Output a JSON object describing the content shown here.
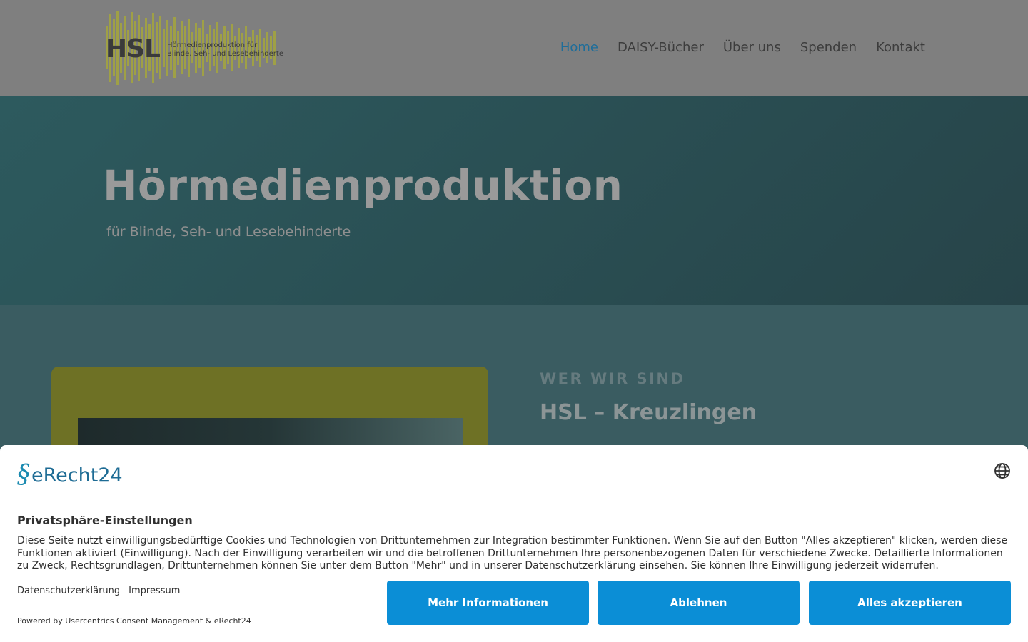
{
  "logo": {
    "brand": "HSL",
    "tagline_line1": "Hörmedienproduktion für",
    "tagline_line2": "Blinde, Seh- und Lesebehinderte"
  },
  "nav": {
    "items": [
      {
        "label": "Home",
        "active": true
      },
      {
        "label": "DAISY-Bücher"
      },
      {
        "label": "Über uns"
      },
      {
        "label": "Spenden"
      },
      {
        "label": "Kontakt"
      }
    ]
  },
  "hero": {
    "title": "Hörmedienproduktion",
    "subtitle": "für Blinde, Seh- und Lesebehinderte"
  },
  "section": {
    "kicker": "WER WIR SIND",
    "title": "HSL – Kreuzlingen"
  },
  "consent": {
    "brand": "eRecht24",
    "title": "Privatsphäre-Einstellungen",
    "text": "Diese Seite nutzt einwilligungsbedürftige Cookies und Technologien von Drittunternehmen zur Integration bestimmter Funktionen. Wenn Sie auf den Button \"Alles akzeptieren\" klicken, werden diese Funktionen aktiviert (Einwilligung). Nach der Einwilligung verarbeiten wir und die betroffenen Drittunternehmen Ihre personenbezogenen Daten für verschiedene Zwecke. Detaillierte Informationen zu Zweck, Rechtsgrundlagen, Drittunternehmen können Sie unter dem Button \"Mehr\" und in unserer Datenschutzerklärung einsehen. Sie können Ihre Einwilligung jederzeit widerrufen.",
    "link_privacy": "Datenschutzerklärung",
    "link_imprint": "Impressum",
    "powered": "Powered by Usercentrics Consent Management & eRecht24",
    "btn_more": "Mehr Informationen",
    "btn_deny": "Ablehnen",
    "btn_accept": "Alles akzeptieren"
  },
  "colors": {
    "nav_active": "#1d6d9a",
    "button": "#0b8ed6",
    "logo_accent": "#a3a440"
  },
  "icons": {
    "language": "globe-icon",
    "brand_mark": "erecht24-logo-icon"
  }
}
